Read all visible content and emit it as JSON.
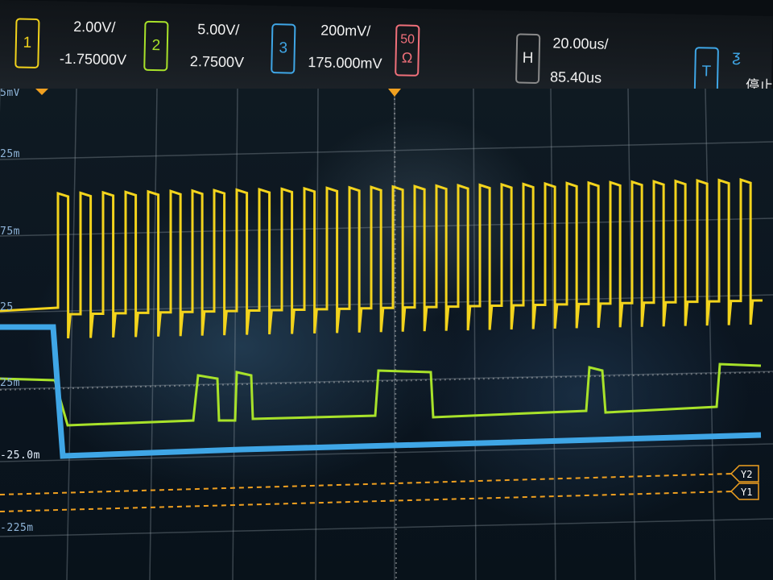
{
  "channels": [
    {
      "id": "1",
      "scale": "2.00V/",
      "offset": "-1.75000V",
      "color": "#f2d31c"
    },
    {
      "id": "2",
      "scale": "5.00V/",
      "offset": "2.7500V",
      "color": "#a8e22a"
    },
    {
      "id": "3",
      "scale": "200mV/",
      "offset": "175.000mV",
      "color": "#3fa6e6"
    }
  ],
  "impedance": {
    "value": "50",
    "unit": "Ω",
    "color": "#f0707a"
  },
  "timebase": {
    "label": "H",
    "scale": "20.00us/",
    "delay": "85.40us"
  },
  "trigger": {
    "label": "T",
    "slope_symbol": "ƺ",
    "state": "停止",
    "color": "#3fa6e6"
  },
  "left_scale_labels": [
    "5mV",
    "25m",
    "75m",
    "25",
    "25m",
    "-25.0m",
    "-225m"
  ],
  "cursors": [
    "Y2",
    "Y1"
  ]
}
